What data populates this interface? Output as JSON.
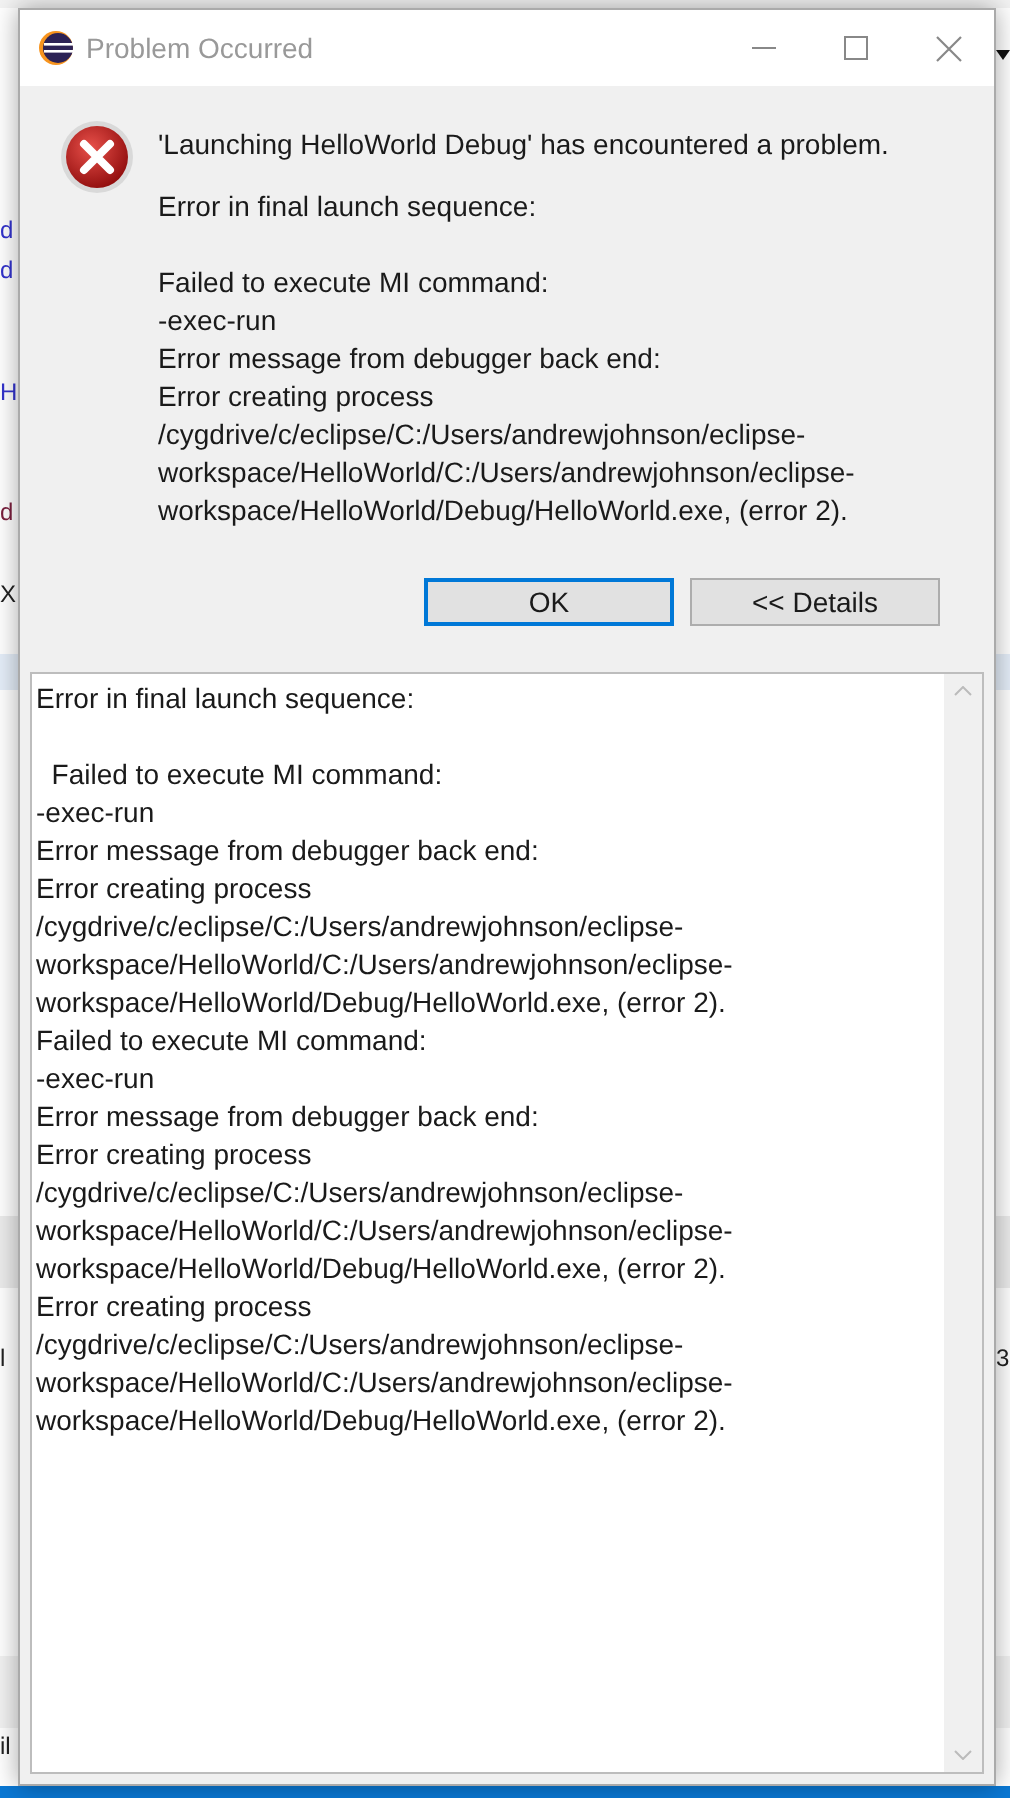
{
  "background": {
    "fragments": [
      {
        "text": "d",
        "color": "#3333cc"
      },
      {
        "text": "d",
        "color": "#3333cc"
      },
      {
        "text": "H",
        "color": "#3333cc"
      },
      {
        "text": "d",
        "color": "#7a1f3d"
      },
      {
        "text": "X",
        "color": "#222222"
      },
      {
        "text": "l",
        "color": "#222222"
      },
      {
        "text": "3",
        "color": "#222222"
      },
      {
        "text": "il",
        "color": "#222222"
      }
    ]
  },
  "window": {
    "title": "Problem Occurred"
  },
  "headline": "'Launching HelloWorld Debug' has encountered a problem.",
  "message": "Error in final launch sequence:\n\nFailed to execute MI command:\n-exec-run\nError message from debugger back end:\nError creating process /cygdrive/c/eclipse/C:/Users/andrewjohnson/eclipse-workspace/HelloWorld/C:/Users/andrewjohnson/eclipse-workspace/HelloWorld/Debug/HelloWorld.exe, (error 2).",
  "buttons": [
    {
      "label": "OK",
      "default": true
    },
    {
      "label": "<< Details",
      "default": false
    }
  ],
  "details": "Error in final launch sequence:\n\n\tFailed to execute MI command:\n-exec-run\nError message from debugger back end:\nError creating process /cygdrive/c/eclipse/C:/Users/andrewjohnson/eclipse-workspace/HelloWorld/C:/Users/andrewjohnson/eclipse-workspace/HelloWorld/Debug/HelloWorld.exe, (error 2).\nFailed to execute MI command:\n-exec-run\nError message from debugger back end:\nError creating process /cygdrive/c/eclipse/C:/Users/andrewjohnson/eclipse-workspace/HelloWorld/C:/Users/andrewjohnson/eclipse-workspace/HelloWorld/Debug/HelloWorld.exe, (error 2).\nError creating process /cygdrive/c/eclipse/C:/Users/andrewjohnson/eclipse-workspace/HelloWorld/C:/Users/andrewjohnson/eclipse-workspace/HelloWorld/Debug/HelloWorld.exe, (error 2)."
}
